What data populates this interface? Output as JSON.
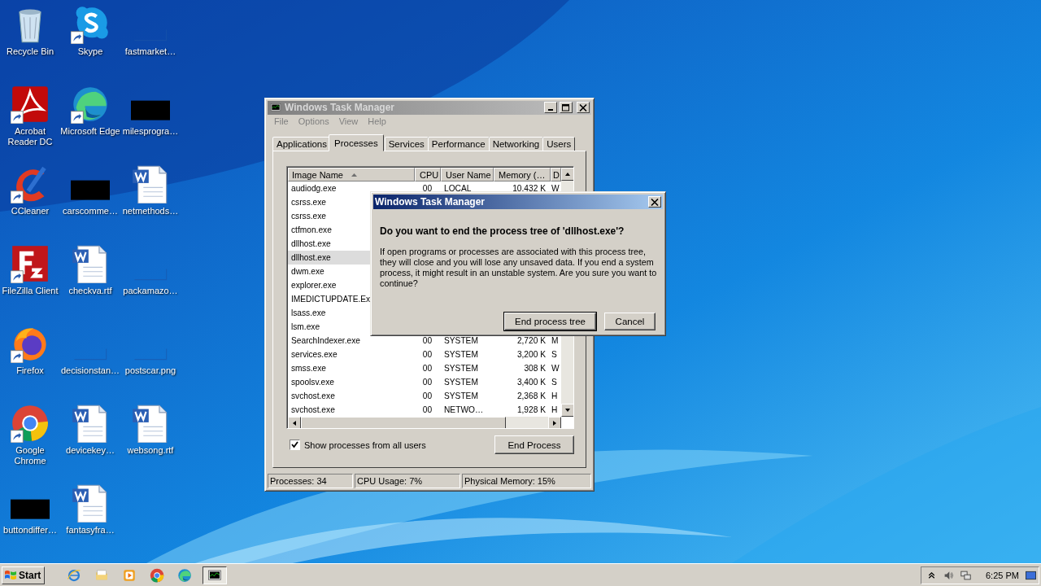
{
  "desktop": {
    "icons": [
      {
        "label": "Recycle Bin",
        "kind": "bin",
        "shortcut": false
      },
      {
        "label": "Skype",
        "kind": "skype",
        "shortcut": true
      },
      {
        "label": "fastmarket…",
        "kind": "blank",
        "shortcut": false
      },
      {
        "label": "Acrobat Reader DC",
        "kind": "acrobat",
        "shortcut": true
      },
      {
        "label": "Microsoft Edge",
        "kind": "edge",
        "shortcut": true
      },
      {
        "label": "milesprogra…",
        "kind": "redacted",
        "shortcut": false
      },
      {
        "label": "CCleaner",
        "kind": "ccleaner",
        "shortcut": true
      },
      {
        "label": "carscomme…",
        "kind": "redacted",
        "shortcut": false
      },
      {
        "label": "netmethods…",
        "kind": "doc",
        "shortcut": false
      },
      {
        "label": "FileZilla Client",
        "kind": "filezilla",
        "shortcut": true
      },
      {
        "label": "checkva.rtf",
        "kind": "doc",
        "shortcut": false
      },
      {
        "label": "packamazo…",
        "kind": "blank",
        "shortcut": false
      },
      {
        "label": "Firefox",
        "kind": "firefox",
        "shortcut": true
      },
      {
        "label": "decisionstan…",
        "kind": "blank",
        "shortcut": false
      },
      {
        "label": "postscar.png",
        "kind": "blank",
        "shortcut": false
      },
      {
        "label": "Google Chrome",
        "kind": "chrome",
        "shortcut": true
      },
      {
        "label": "devicekey…",
        "kind": "doc",
        "shortcut": false
      },
      {
        "label": "websong.rtf",
        "kind": "doc",
        "shortcut": false
      },
      {
        "label": "buttondiffer…",
        "kind": "redacted",
        "shortcut": false
      },
      {
        "label": "fantasyfra…",
        "kind": "doc",
        "shortcut": false
      }
    ]
  },
  "task_manager": {
    "title": "Windows Task Manager",
    "menu": [
      "File",
      "Options",
      "View",
      "Help"
    ],
    "tabs": [
      {
        "label": "Applications",
        "selected": false
      },
      {
        "label": "Processes",
        "selected": true
      },
      {
        "label": "Services",
        "selected": false
      },
      {
        "label": "Performance",
        "selected": false
      },
      {
        "label": "Networking",
        "selected": false
      },
      {
        "label": "Users",
        "selected": false
      }
    ],
    "columns": [
      {
        "label": "Image Name",
        "sorted": true
      },
      {
        "label": "CPU",
        "sorted": false
      },
      {
        "label": "User Name",
        "sorted": false
      },
      {
        "label": "Memory (…",
        "sorted": false
      },
      {
        "label": "D",
        "sorted": false
      }
    ],
    "rows": [
      {
        "name": "audiodg.exe",
        "cpu": "00",
        "user": "LOCAL",
        "memory": "10,432 K",
        "desc": "W",
        "selected": false
      },
      {
        "name": "csrss.exe",
        "selected": false
      },
      {
        "name": "csrss.exe",
        "selected": false
      },
      {
        "name": "ctfmon.exe",
        "selected": false
      },
      {
        "name": "dllhost.exe",
        "selected": false
      },
      {
        "name": "dllhost.exe",
        "selected": true
      },
      {
        "name": "dwm.exe",
        "selected": false
      },
      {
        "name": "explorer.exe",
        "selected": false
      },
      {
        "name": "IMEDICTUPDATE.Ex",
        "selected": false
      },
      {
        "name": "lsass.exe",
        "selected": false
      },
      {
        "name": "lsm.exe",
        "selected": false
      },
      {
        "name": "SearchIndexer.exe",
        "cpu": "00",
        "user": "SYSTEM",
        "memory": "2,720 K",
        "desc": "M",
        "selected": false
      },
      {
        "name": "services.exe",
        "cpu": "00",
        "user": "SYSTEM",
        "memory": "3,200 K",
        "desc": "S",
        "selected": false
      },
      {
        "name": "smss.exe",
        "cpu": "00",
        "user": "SYSTEM",
        "memory": "308 K",
        "desc": "W",
        "selected": false
      },
      {
        "name": "spoolsv.exe",
        "cpu": "00",
        "user": "SYSTEM",
        "memory": "3,400 K",
        "desc": "S",
        "selected": false
      },
      {
        "name": "svchost.exe",
        "cpu": "00",
        "user": "SYSTEM",
        "memory": "2,368 K",
        "desc": "H",
        "selected": false
      },
      {
        "name": "svchost.exe",
        "cpu": "00",
        "user": "NETWO…",
        "memory": "1,928 K",
        "desc": "H",
        "selected": false
      }
    ],
    "show_all_users": {
      "label": "Show processes from all users",
      "checked": true
    },
    "end_button": "End Process",
    "status": [
      "Processes: 34",
      "CPU Usage: 7%",
      "Physical Memory: 15%"
    ]
  },
  "dialog": {
    "title": "Windows Task Manager",
    "question": "Do you want to end the process tree of 'dllhost.exe'?",
    "message": "If open programs or processes are associated with this process tree, they will close and you will lose any unsaved data. If you end a system process, it might result in an unstable system. Are you sure you want to continue?",
    "buttons": [
      {
        "label": "End process tree",
        "default": true
      },
      {
        "label": "Cancel",
        "default": false
      }
    ]
  },
  "taskbar": {
    "start": "Start",
    "apps": [
      {
        "kind": "ie",
        "active": false
      },
      {
        "kind": "folder",
        "active": false
      },
      {
        "kind": "media",
        "active": false
      },
      {
        "kind": "chrome",
        "active": false
      },
      {
        "kind": "edge",
        "active": false
      },
      {
        "kind": "taskmgr",
        "active": true
      }
    ],
    "clock": "6:25 PM"
  }
}
